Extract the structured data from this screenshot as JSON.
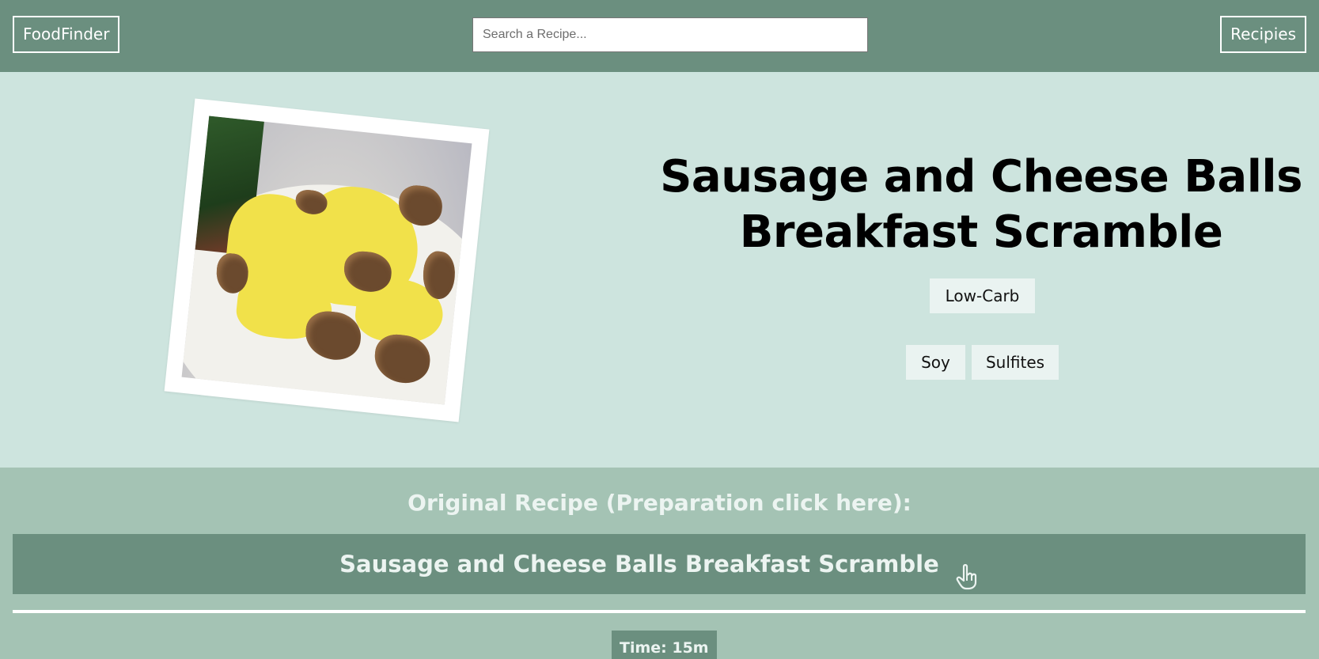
{
  "header": {
    "brand": "FoodFinder",
    "search_placeholder": "Search a Recipe...",
    "nav_recipes": "Recipies"
  },
  "recipe": {
    "title": "Sausage and Cheese Balls Breakfast Scramble",
    "diet_tags": [
      "Low-Carb"
    ],
    "allergen_tags": [
      "Soy",
      "Sulfites"
    ],
    "photo_name": "scrambled-eggs-with-sausage-balls-photo"
  },
  "original": {
    "heading": "Original Recipe (Preparation click here):",
    "link_label": "Sausage and Cheese Balls Breakfast Scramble",
    "link_icon": "pointing-hand-icon"
  },
  "meta": {
    "time": "Time: 15m"
  },
  "colors": {
    "header_bg": "#6b8f7f",
    "hero_bg": "#cde4de",
    "lower_bg": "#a4c3b4",
    "tag_bg": "#eaf3f1",
    "light_text": "#ecf4f1"
  }
}
